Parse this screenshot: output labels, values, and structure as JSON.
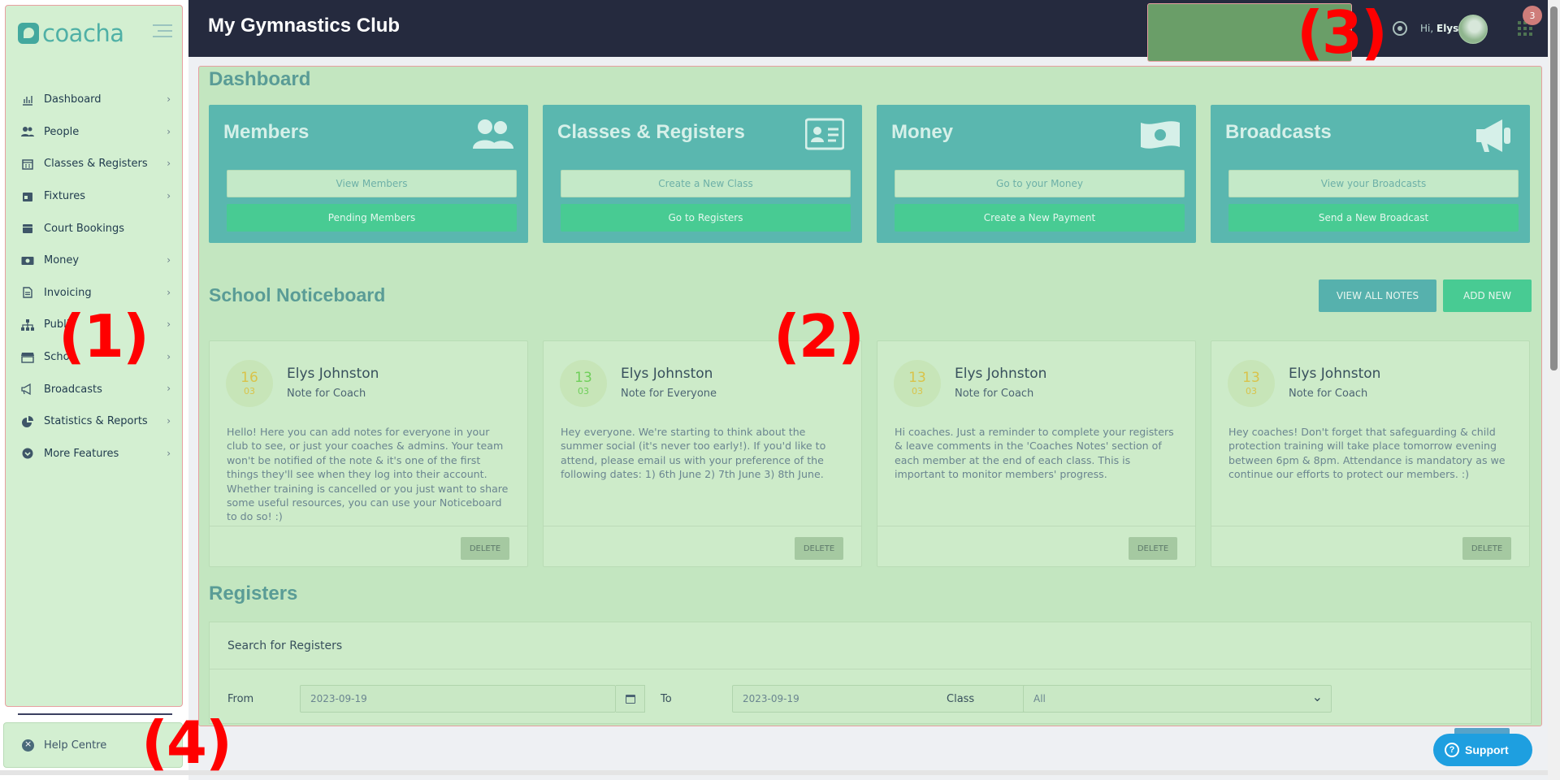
{
  "app": {
    "logo": "coacha",
    "page_title": "My Gymnastics Club"
  },
  "sidebar": {
    "items": [
      {
        "label": "Dashboard",
        "icon": "bar-chart-icon",
        "chevron": true
      },
      {
        "label": "People",
        "icon": "users-icon",
        "chevron": true
      },
      {
        "label": "Classes & Registers",
        "icon": "calendar-grid-icon",
        "chevron": true
      },
      {
        "label": "Fixtures",
        "icon": "calendar-icon",
        "chevron": true
      },
      {
        "label": "Court Bookings",
        "icon": "calendar-icon",
        "chevron": false
      },
      {
        "label": "Money",
        "icon": "banknote-icon",
        "chevron": true
      },
      {
        "label": "Invoicing",
        "icon": "file-icon",
        "chevron": true
      },
      {
        "label": "Publi",
        "icon": "sitemap-icon",
        "chevron": true
      },
      {
        "label": "Scho",
        "icon": "store-icon",
        "chevron": true
      },
      {
        "label": "Broadcasts",
        "icon": "megaphone-icon",
        "chevron": true
      },
      {
        "label": "Statistics & Reports",
        "icon": "pie-chart-icon",
        "chevron": true
      },
      {
        "label": "More Features",
        "icon": "chevron-circle-icon",
        "chevron": true
      }
    ],
    "help": "Help Centre"
  },
  "topbar": {
    "greeting": "Hi,",
    "user": "Elys",
    "badge": "3"
  },
  "dashboard": {
    "heading": "Dashboard",
    "cards": [
      {
        "title": "Members",
        "icon": "users-icon",
        "primary": "View Members",
        "secondary": "Pending Members"
      },
      {
        "title": "Classes & Registers",
        "icon": "id-card-icon",
        "primary": "Create a New Class",
        "secondary": "Go to Registers"
      },
      {
        "title": "Money",
        "icon": "banknote-icon",
        "primary": "Go to your Money",
        "secondary": "Create a New Payment"
      },
      {
        "title": "Broadcasts",
        "icon": "megaphone-icon",
        "primary": "View your Broadcasts",
        "secondary": "Send a New Broadcast"
      }
    ]
  },
  "noticeboard": {
    "heading": "School Noticeboard",
    "view_all": "VIEW ALL NOTES",
    "add_new": "ADD NEW",
    "delete_label": "DELETE",
    "notes": [
      {
        "day": "16",
        "month": "03",
        "day_color": "#d9c34a",
        "author": "Elys Johnston",
        "audience": "Note for Coach",
        "body": "Hello! Here you can add notes for everyone in your club to see, or just your coaches & admins. Your team won't be notified of the note & it's one of the first things they'll see when they log into their account. Whether training is cancelled or you just want to share some useful resources, you can use your Noticeboard to do so! :)"
      },
      {
        "day": "13",
        "month": "03",
        "day_color": "#6fcf5a",
        "author": "Elys Johnston",
        "audience": "Note for Everyone",
        "body": "Hey everyone. We're starting to think about the summer social (it's never too early!). If you'd like to attend, please email us with your preference of the following dates: 1) 6th June 2) 7th June 3) 8th June."
      },
      {
        "day": "13",
        "month": "03",
        "day_color": "#d9c34a",
        "author": "Elys Johnston",
        "audience": "Note for Coach",
        "body": "Hi coaches. Just a reminder to complete your registers & leave comments in the 'Coaches Notes' section of each member at the end of each class. This is important to monitor members' progress."
      },
      {
        "day": "13",
        "month": "03",
        "day_color": "#d9c34a",
        "author": "Elys Johnston",
        "audience": "Note for Coach",
        "body": "Hey coaches! Don't forget that safeguarding & child protection training will take place tomorrow evening between 6pm & 8pm. Attendance is mandatory as we continue our efforts to protect our members. :)"
      }
    ]
  },
  "registers": {
    "heading": "Registers",
    "panel_title": "Search for Registers",
    "from_label": "From",
    "from_value": "2023-09-19",
    "to_label": "To",
    "to_value": "2023-09-19",
    "class_label": "Class",
    "class_value": "All"
  },
  "support": "Support",
  "markers": [
    "(1)",
    "(2)",
    "(3)",
    "(4)"
  ]
}
